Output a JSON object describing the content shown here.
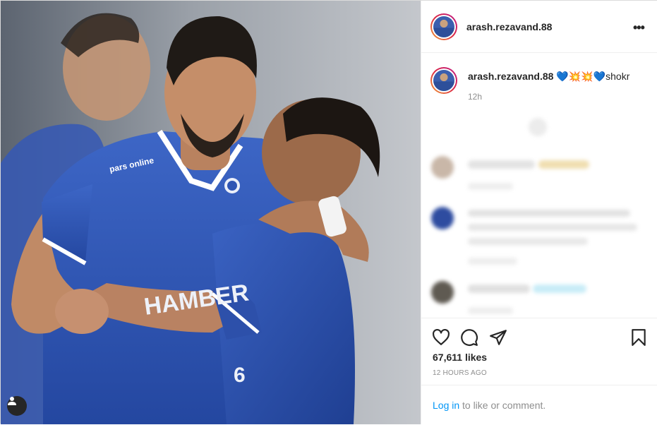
{
  "post": {
    "username": "arash.rezavand.88",
    "more_label": "•••",
    "caption": {
      "username": "arash.rezavand.88",
      "emoji": "💙💥💥💙",
      "text": "shokr"
    },
    "caption_time": "12h",
    "likes": "67,611 likes",
    "time_ago": "12 HOURS AGO",
    "login_link": "Log in",
    "login_rest": "to like or comment."
  },
  "photo": {
    "jersey_sponsor": "pars online",
    "jersey_text": "HAMBER",
    "jersey_number": "6"
  },
  "colors": {
    "jersey_blue": "#2f55b4",
    "link_blue": "#0095f6",
    "muted_gray": "#8e8e8e"
  },
  "icons": [
    "heart-icon",
    "comment-icon",
    "share-icon",
    "bookmark-icon",
    "user-tag-icon",
    "more-icon"
  ]
}
